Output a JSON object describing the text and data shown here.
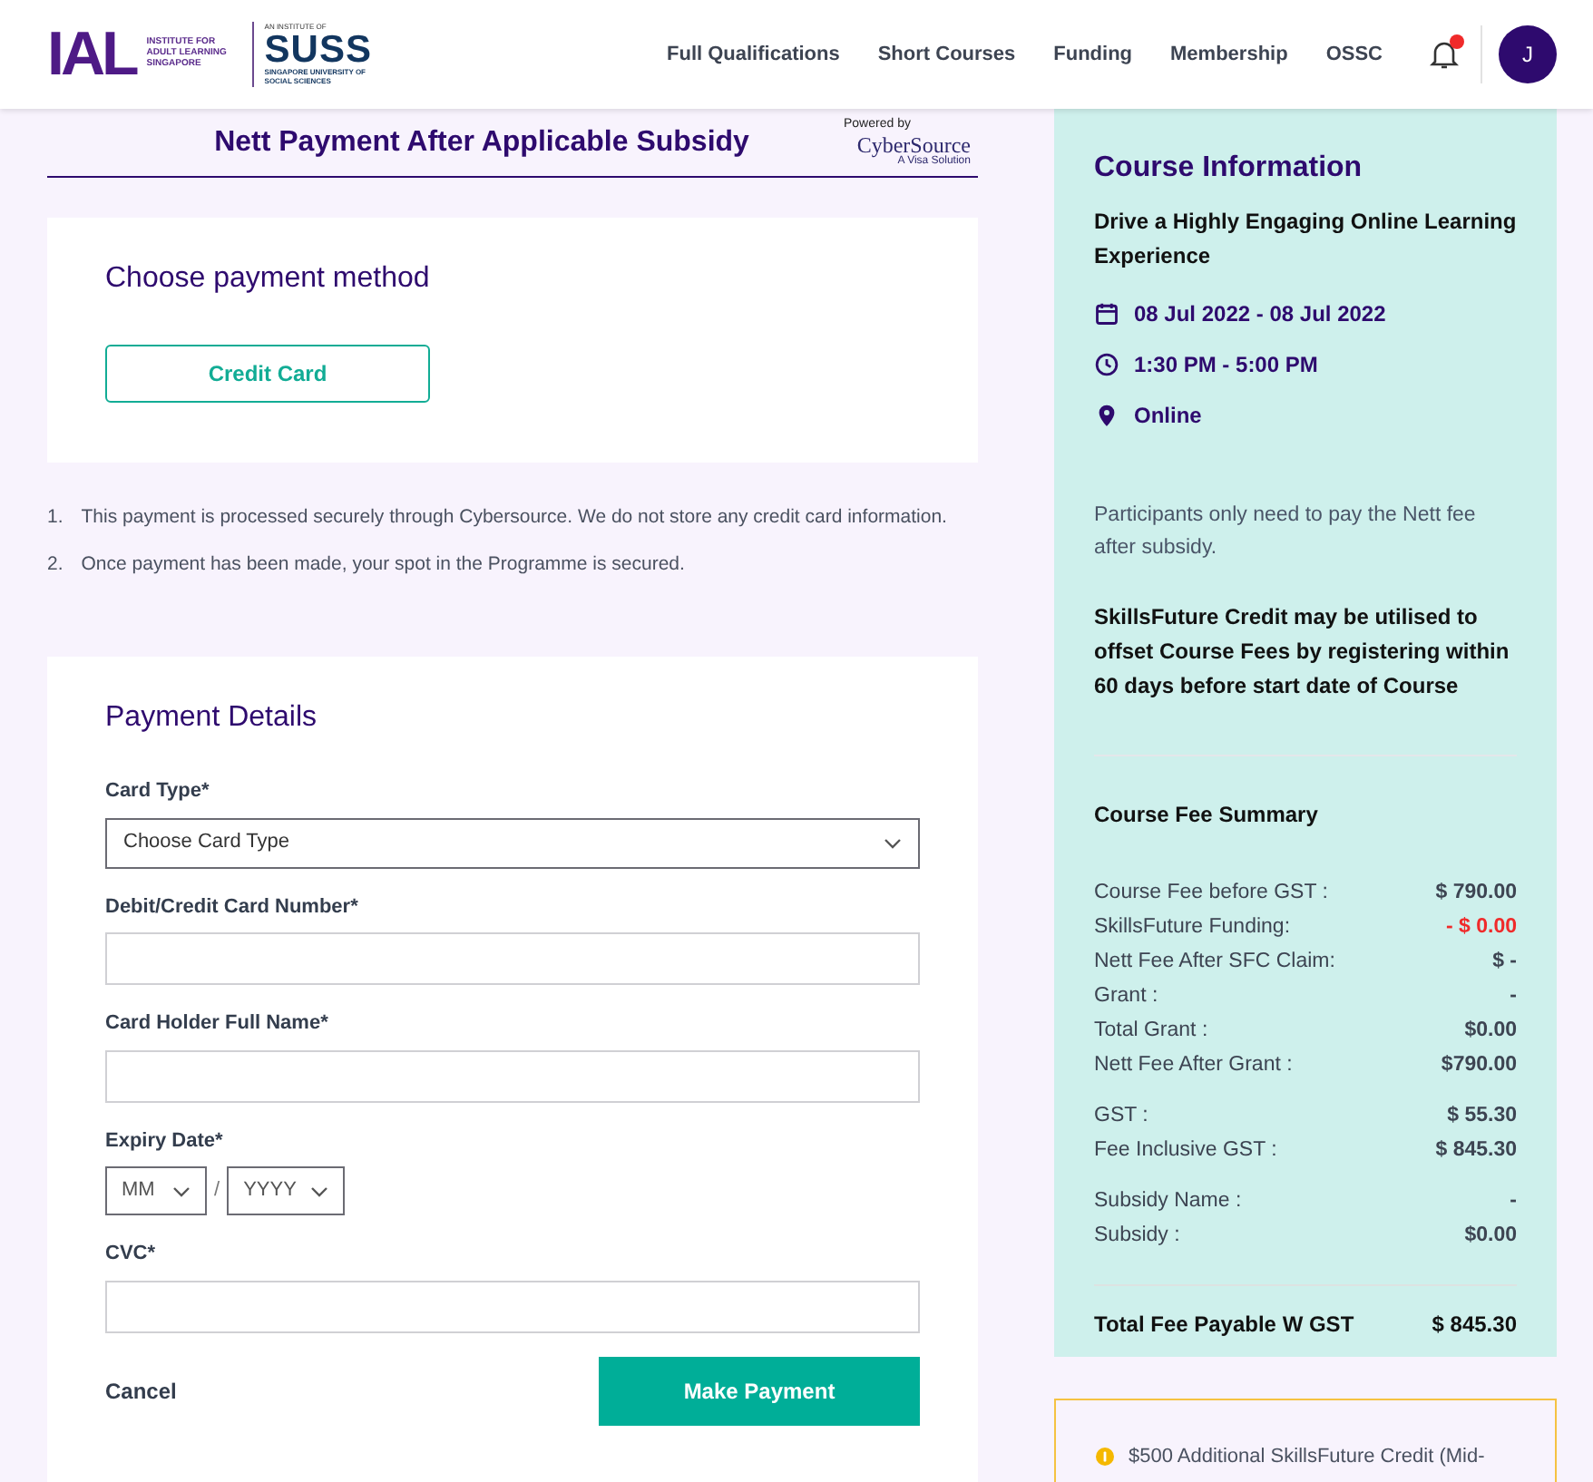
{
  "header": {
    "logo": {
      "mark": "IAL",
      "name": "INSTITUTE FOR ADULT LEARNING SINGAPORE",
      "affiliation": "AN INSTITUTE OF",
      "partner": "SUSS",
      "partner_name": "SINGAPORE UNIVERSITY OF SOCIAL SCIENCES"
    },
    "nav": [
      "Full Qualifications",
      "Short Courses",
      "Funding",
      "Membership",
      "OSSC"
    ],
    "notifications": {
      "unread": true
    },
    "avatar": "J"
  },
  "page_title": "Nett Payment After Applicable Subsidy",
  "powered_by": {
    "label": "Powered by",
    "brand": "CyberSource",
    "tagline": "A Visa Solution"
  },
  "payment_method": {
    "heading": "Choose payment method",
    "options": [
      {
        "label": "Credit Card",
        "selected": true
      }
    ]
  },
  "notes": [
    {
      "number": "1.",
      "text": "This payment is processed securely through Cybersource. We do not store any credit card information."
    },
    {
      "number": "2.",
      "text": "Once payment has been made, your spot in the Programme is secured."
    }
  ],
  "payment_details": {
    "heading": "Payment Details",
    "fields": [
      {
        "kind": "select",
        "label": "Card Type*",
        "placeholder": "Choose Card Type"
      },
      {
        "kind": "text",
        "label": "Debit/Credit Card Number*"
      },
      {
        "kind": "text",
        "label": "Card Holder Full Name*"
      },
      {
        "kind": "expiry",
        "label": "Expiry Date*",
        "month": "MM",
        "separator": "/",
        "year": "YYYY"
      },
      {
        "kind": "text",
        "label": "CVC*"
      }
    ],
    "cancel": "Cancel",
    "submit": "Make Payment"
  },
  "course_info": {
    "heading": "Course Information",
    "title": "Drive a Highly Engaging Online Learning Experience",
    "details": [
      {
        "kind": "date",
        "text": "08 Jul 2022 - 08 Jul 2022"
      },
      {
        "kind": "time",
        "text": "1:30 PM - 5:00 PM"
      },
      {
        "kind": "location",
        "text": "Online"
      }
    ],
    "note": "Participants only need to pay the Nett fee after subsidy.",
    "sfc_note": "SkillsFuture Credit may be utilised to offset Course Fees by registering within 60 days before start date of Course",
    "summary_heading": "Course Fee Summary",
    "fee_groups": [
      [
        {
          "label": "Course Fee before GST :",
          "value": "$ 790.00",
          "kind": "normal"
        },
        {
          "label": "SkillsFuture Funding:",
          "value": "- $ 0.00",
          "kind": "deduction"
        },
        {
          "label": "Nett Fee After SFC Claim:",
          "value": "$ -",
          "kind": "normal"
        },
        {
          "label": "Grant :",
          "value": "-",
          "kind": "normal"
        },
        {
          "label": "Total Grant :",
          "value": "$0.00",
          "kind": "normal"
        },
        {
          "label": "Nett Fee After Grant :",
          "value": "$790.00",
          "kind": "normal"
        }
      ],
      [
        {
          "label": "GST :",
          "value": "$ 55.30",
          "kind": "normal"
        },
        {
          "label": "Fee Inclusive GST :",
          "value": "$ 845.30",
          "kind": "normal"
        }
      ],
      [
        {
          "label": "Subsidy Name :",
          "value": "-",
          "kind": "normal"
        },
        {
          "label": "Subsidy :",
          "value": "$0.00",
          "kind": "normal"
        }
      ]
    ],
    "total": {
      "label": "Total Fee Payable W GST",
      "value": "$ 845.30"
    }
  },
  "notice": {
    "text": "$500 Additional SkillsFuture Credit (Mid-"
  }
}
